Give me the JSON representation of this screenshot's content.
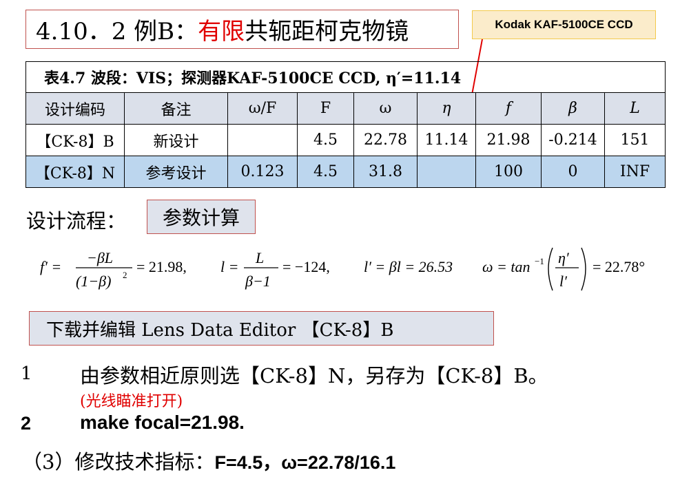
{
  "title": {
    "prefix": "4.10．2 例B：",
    "highlight": "有限",
    "suffix": "共轭距柯克物镜"
  },
  "callout": "Kodak KAF-5100CE CCD",
  "table": {
    "caption": "表4.7  波段：VIS；探测器KAF-5100CE CCD,   η′=11.14",
    "headers": [
      "设计编码",
      "备注",
      "ω/F",
      "F",
      "ω",
      "η",
      "f",
      "β",
      "L"
    ],
    "rows": [
      [
        "【CK-8】B",
        "新设计",
        "",
        "4.5",
        "22.78",
        "11.14",
        "21.98",
        "-0.214",
        "151"
      ],
      [
        "【CK-8】N",
        "参考设计",
        "0.123",
        "4.5",
        "31.8",
        "",
        "100",
        "0",
        "INF"
      ]
    ]
  },
  "process": {
    "label": "设计流程：",
    "button": "参数计算"
  },
  "formula": {
    "f_lhs": "f′ =",
    "f_num": "−βL",
    "f_den": "(1−β)",
    "f_exp": "2",
    "f_val": "= 21.98,",
    "l_lhs": "l =",
    "l_num": "L",
    "l_den": "β−1",
    "l_val": "= −124,",
    "lp": "l′ = βl = 26.53",
    "w_lhs": "ω = tan",
    "w_exp": "−1",
    "w_num": "η′",
    "w_den": "l′",
    "w_val": "= 22.78°"
  },
  "download": "下载并编辑 Lens Data Editor 【CK-8】B",
  "steps": {
    "s1_num": "1",
    "s1_text": "由参数相近原则选【CK-8】N，另存为【CK-8】B。",
    "s1_note": "(光线瞄准打开)",
    "s2_num": "2",
    "s2_text": "make focal=21.98.",
    "s3_prefix": "（3）修改技术指标：",
    "s3_f": "F=4.5，",
    "s3_w": "ω=22.78/16.1"
  },
  "colors": {
    "title_highlight": "#e00000",
    "box_border": "#c0504d",
    "header_row_bg": "#dbe0ea",
    "highlight_row_bg": "#bcd6ee",
    "callout_bg": "#fbeccb",
    "arrow": "#e00000"
  }
}
